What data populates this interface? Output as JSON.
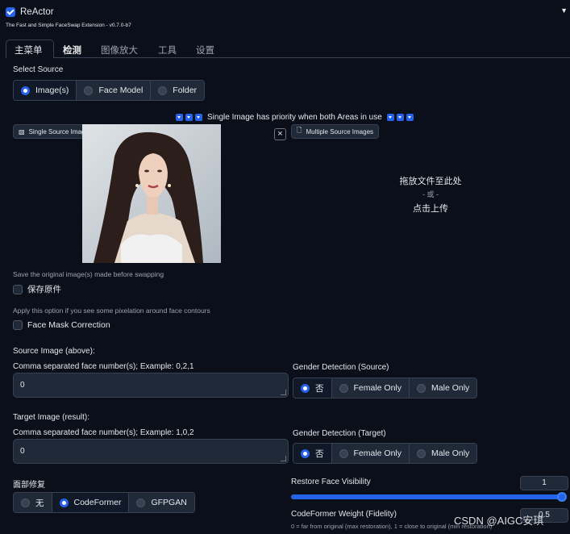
{
  "header": {
    "title": "ReActor",
    "subtitle": "The Fast and Simple FaceSwap Extension - v0.7.0-b7"
  },
  "tabs": [
    "主菜单",
    "检测",
    "图像放大",
    "工具",
    "设置"
  ],
  "source": {
    "label": "Select Source",
    "options": [
      "Image(s)",
      "Face Model",
      "Folder"
    ]
  },
  "priority_note": "Single Image has priority when both Areas in use",
  "single_image_tab": "Single Source Image",
  "multiple_images_tab": "Multiple Source Images",
  "upload": {
    "drop": "拖放文件至此处",
    "or": "- 或 -",
    "click": "点击上传"
  },
  "save_original": {
    "hint": "Save the original image(s) made before swapping",
    "label": "保存原件"
  },
  "face_mask": {
    "hint": "Apply this option if you see some pixelation around face contours",
    "label": "Face Mask Correction"
  },
  "source_image": {
    "title": "Source Image (above):",
    "field_label": "Comma separated face number(s); Example: 0,2,1",
    "value": "0"
  },
  "target_image": {
    "title": "Target Image (result):",
    "field_label": "Comma separated face number(s); Example: 1,0,2",
    "value": "0"
  },
  "gender_source": {
    "label": "Gender Detection (Source)",
    "options": [
      "否",
      "Female Only",
      "Male Only"
    ]
  },
  "gender_target": {
    "label": "Gender Detection (Target)",
    "options": [
      "否",
      "Female Only",
      "Male Only"
    ]
  },
  "restore": {
    "label": "面部修复",
    "options": [
      "无",
      "CodeFormer",
      "GFPGAN"
    ]
  },
  "visibility": {
    "label": "Restore Face Visibility",
    "value": "1",
    "fraction": 1.0
  },
  "codeformer": {
    "label": "CodeFormer Weight (Fidelity)",
    "hint": "0 = far from original (max restoration), 1 = close to original (min restoration)",
    "value": "0.5"
  },
  "watermark": "CSDN @AIGC安琪",
  "colors": {
    "accent": "#2563eb",
    "background": "#0b0f19",
    "panel": "#1f2937"
  }
}
